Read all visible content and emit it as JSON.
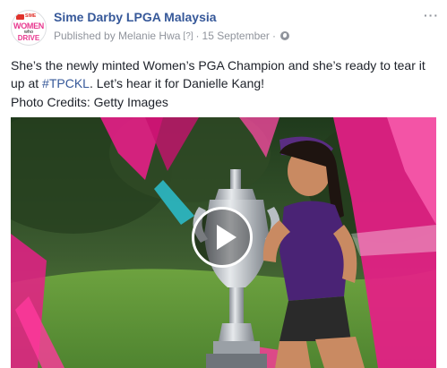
{
  "post": {
    "page_name": "Sime Darby LPGA Malaysia",
    "published_by": "Published by Melanie Hwa",
    "help_marker": "[?]",
    "separator": "·",
    "date": "15 September",
    "separator2": "·",
    "privacy_icon": "globe-icon",
    "more_icon": "more-options-icon",
    "more_glyph": "···",
    "text_before": "She’s the newly minted Women’s PGA Champion and she’s ready to tear it up at ",
    "hashtag": "#TPCKL",
    "text_after": ". Let’s hear it for Danielle Kang!",
    "credits": "Photo Credits: Getty Images"
  },
  "avatar": {
    "badge_text": "SIME",
    "line1": "WOMEN",
    "line2": "who",
    "line3": "DRIVE"
  },
  "video": {
    "play_icon": "play-icon"
  },
  "colors": {
    "link": "#365899",
    "meta": "#90949c",
    "brand_pink": "#e8388f"
  }
}
